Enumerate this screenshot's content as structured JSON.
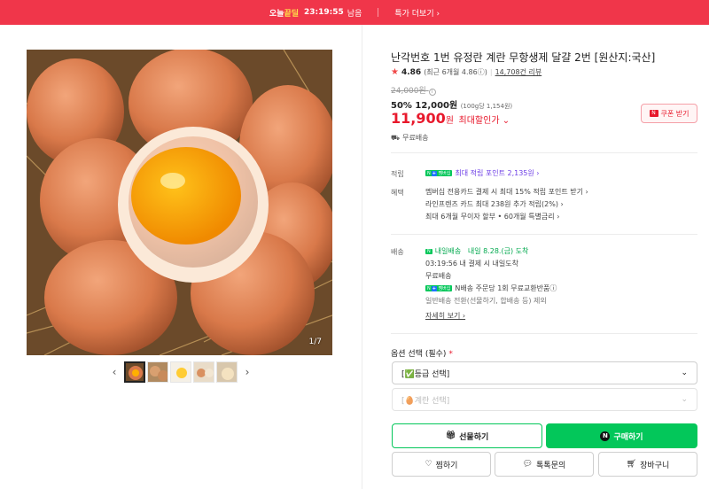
{
  "topbar": {
    "deal_prefix": "오늘",
    "deal_highlight": "끝딜",
    "timer": "23:19:55",
    "timer_suffix": "남음",
    "special_link": "특가 더보기 ›"
  },
  "gallery": {
    "counter": "1/7",
    "prev": "‹",
    "next": "›"
  },
  "product": {
    "title": "난각번호 1번 유정란 계란 무항생제 달걀 2번 [원산지:국산]",
    "rating_score": "4.86",
    "rating_recent": "(최근 6개월 4.86ⓘ)",
    "review_count": "14,708건 리뷰",
    "original_price": "24,000원",
    "discount_rate": "50%",
    "discount_price": "12,000원",
    "unit_price": "(100g당 1,154원)",
    "final_price": "11,900",
    "final_price_unit": "원",
    "max_discount_label": "최대할인가 ⌄",
    "coupon_label": "쿠폰 받기",
    "free_shipping": "무료배송"
  },
  "benefits": {
    "points_label": "적립",
    "points_text": "최대 적립 포인트 2,135원 ›",
    "benefit_label": "혜택",
    "benefit_lines": [
      "멤버십 전용카드 결제 시 최대 15% 적립 포인트 받기 ›",
      "라인프렌즈 카드 최대 238원 추가 적립(2%) ›",
      "최대 6개월 무이자 할부 • 60개월 특별금리 ›"
    ]
  },
  "delivery": {
    "label": "배송",
    "nday": "내일배송",
    "arrival": "내일 8.28.(금) 도착",
    "cutoff": "03:19:56  내 결제 시 내일도착",
    "free": "무료배송",
    "exchange": "N배송 주문당 1회 무료교환반품ⓘ",
    "exchange_note": "일반배송 전환(선물하기, 합배송 등) 제외",
    "more": "자세히 보기 ›"
  },
  "options": {
    "label": "옵션 선택 (필수)",
    "required_mark": "*",
    "grade_select": "[✅등급 선택]",
    "egg_select": "[🥚계란 선택]"
  },
  "actions": {
    "gift": "선물하기",
    "buy": "구매하기",
    "wish": "찜하기",
    "talk": "톡톡문의",
    "cart": "장바구니"
  },
  "colors": {
    "brand_red": "#f0364a",
    "price_red": "#e8192c",
    "naver_green": "#03c75a"
  }
}
